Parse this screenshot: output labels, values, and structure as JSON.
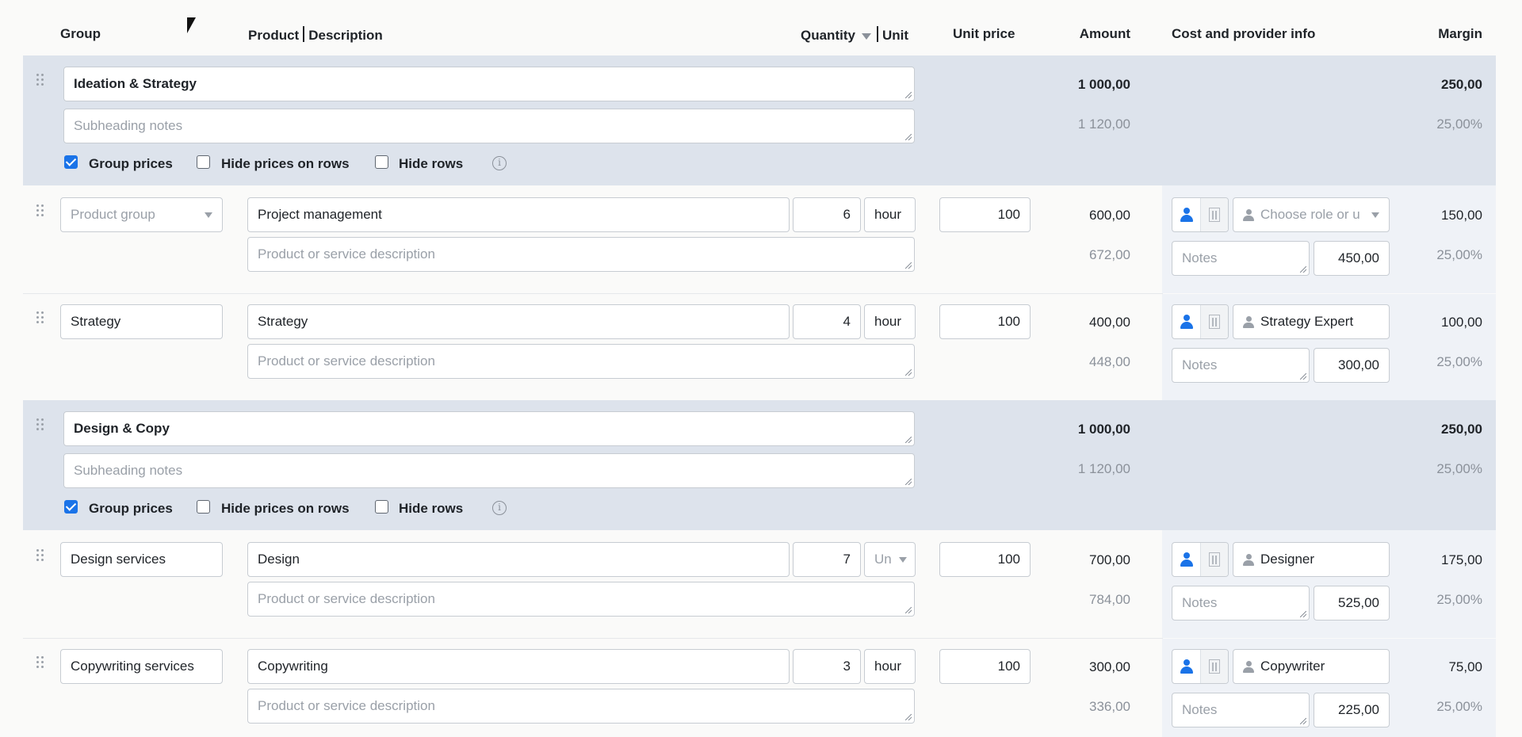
{
  "headers": {
    "group": "Group",
    "product": "Product",
    "description": "Description",
    "quantity": "Quantity",
    "unit": "Unit",
    "unit_price": "Unit price",
    "amount": "Amount",
    "cost_info": "Cost and provider info",
    "margin": "Margin"
  },
  "groups": [
    {
      "title": "Ideation & Strategy",
      "subheading_placeholder": "Subheading notes",
      "amount": "1 000,00",
      "amount_with_tax": "1 120,00",
      "margin": "250,00",
      "margin_pct": "25,00%",
      "opt_group_prices": "Group prices",
      "opt_group_prices_checked": true,
      "opt_hide_prices": "Hide prices on rows",
      "opt_hide_prices_checked": false,
      "opt_hide_rows": "Hide rows",
      "opt_hide_rows_checked": false
    },
    {
      "title": "Design & Copy",
      "subheading_placeholder": "Subheading notes",
      "amount": "1 000,00",
      "amount_with_tax": "1 120,00",
      "margin": "250,00",
      "margin_pct": "25,00%",
      "opt_group_prices": "Group prices",
      "opt_group_prices_checked": true,
      "opt_hide_prices": "Hide prices on rows",
      "opt_hide_prices_checked": false,
      "opt_hide_rows": "Hide rows",
      "opt_hide_rows_checked": false
    }
  ],
  "rows": [
    {
      "group": "",
      "group_placeholder": "Product group",
      "product": "Project management",
      "description_placeholder": "Product or service description",
      "quantity": "6",
      "unit": "hour",
      "unit_price": "100",
      "amount": "600,00",
      "amount_with_tax": "672,00",
      "role": "",
      "role_placeholder": "Choose role or u",
      "notes_placeholder": "Notes",
      "cost": "450,00",
      "margin": "150,00",
      "margin_pct": "25,00%"
    },
    {
      "group": "Strategy",
      "product": "Strategy",
      "description_placeholder": "Product or service description",
      "quantity": "4",
      "unit": "hour",
      "unit_price": "100",
      "amount": "400,00",
      "amount_with_tax": "448,00",
      "role": "Strategy Expert",
      "notes_placeholder": "Notes",
      "cost": "300,00",
      "margin": "100,00",
      "margin_pct": "25,00%"
    },
    {
      "group": "Design services",
      "product": "Design",
      "description_placeholder": "Product or service description",
      "quantity": "7",
      "unit": "",
      "unit_placeholder": "Un",
      "unit_price": "100",
      "amount": "700,00",
      "amount_with_tax": "784,00",
      "role": "Designer",
      "notes_placeholder": "Notes",
      "cost": "525,00",
      "margin": "175,00",
      "margin_pct": "25,00%"
    },
    {
      "group": "Copywriting services",
      "product": "Copywriting",
      "description_placeholder": "Product or service description",
      "quantity": "3",
      "unit": "hour",
      "unit_price": "100",
      "amount": "300,00",
      "amount_with_tax": "336,00",
      "role": "Copywriter",
      "notes_placeholder": "Notes",
      "cost": "225,00",
      "margin": "75,00",
      "margin_pct": "25,00%"
    }
  ]
}
